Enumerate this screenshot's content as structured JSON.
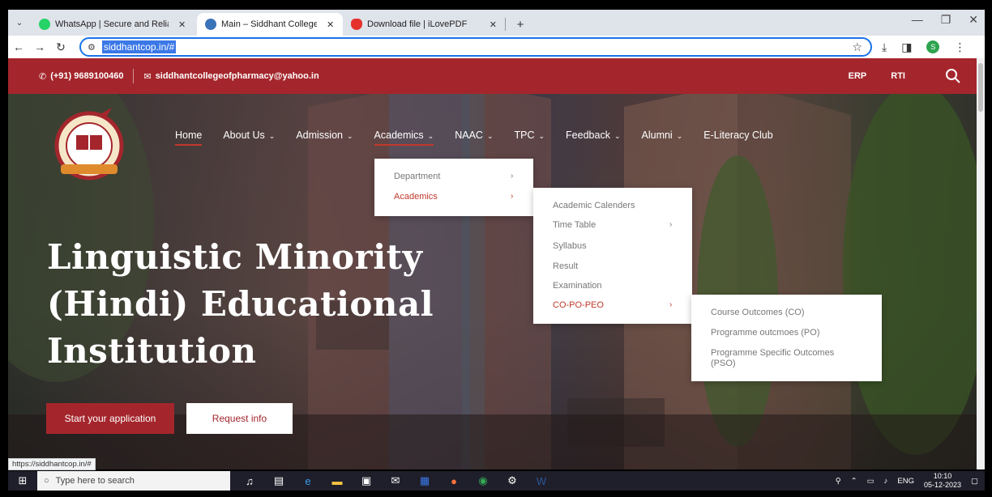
{
  "browser": {
    "tabs": [
      {
        "title": "WhatsApp | Secure and Reliable",
        "close": "✕",
        "favicon_color": "#25d366"
      },
      {
        "title": "Main – Siddhant College of Pha",
        "close": "✕",
        "favicon_color": "#3b73b9"
      },
      {
        "title": "Download file | iLovePDF",
        "close": "✕",
        "favicon_color": "#e5322d"
      }
    ],
    "new_tab": "+",
    "url": "siddhantcop.in/#",
    "window_controls": {
      "minimize": "—",
      "maximize": "❐",
      "close": "✕"
    }
  },
  "topbar": {
    "phone": "(+91) 9689100460",
    "email": "siddhantcollegeofpharmacy@yahoo.in",
    "erp": "ERP",
    "rti": "RTI"
  },
  "nav": {
    "home": "Home",
    "about": "About Us",
    "admission": "Admission",
    "academics": "Academics",
    "naac": "NAAC",
    "tpc": "TPC",
    "feedback": "Feedback",
    "alumni": "Alumni",
    "eliteracy": "E-Literacy Club"
  },
  "menu1": {
    "department": "Department",
    "academics": "Academics"
  },
  "menu2": {
    "calendars": "Academic Calenders",
    "timetable": "Time Table",
    "syllabus": "Syllabus",
    "result": "Result",
    "examination": "Examination",
    "copopeo": "CO-PO-PEO"
  },
  "menu3": {
    "co": "Course Outcomes (CO)",
    "po": "Programme outcmoes (PO)",
    "pso1": "Programme Specific Outcomes",
    "pso2": "(PSO)"
  },
  "hero": {
    "line1": "Linguistic Minority",
    "line2": "(Hindi) Educational",
    "line3": "Institution"
  },
  "buttons": {
    "apply": "Start your application",
    "info": "Request info"
  },
  "logo": {
    "established": "ESTABLISHED IN",
    "year": "2004",
    "name": "CAYMET"
  },
  "status_url": "https://siddhantcop.in/#",
  "taskbar": {
    "search_placeholder": "Type here to search",
    "lang": "ENG",
    "time": "10:10",
    "date": "05-12-2023"
  },
  "colors": {
    "brand_red": "#a4262c",
    "accent_red": "#c0392b",
    "link_blue": "#1a73e8"
  }
}
